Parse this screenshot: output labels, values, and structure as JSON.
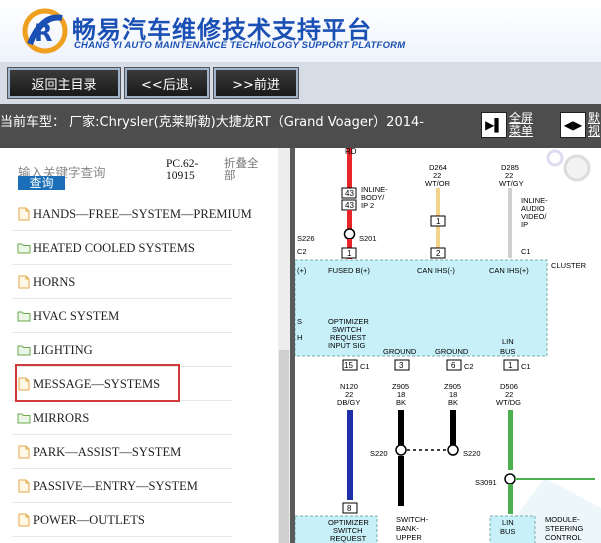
{
  "header": {
    "title_cn": "畅易汽车维修技术支持平台",
    "title_en": "CHANG YI AUTO MAINTENANCE TECHNOLOGY SUPPORT PLATFORM"
  },
  "toolbar": {
    "back_home": "返回主目录",
    "prev": "<<后退.",
    "next": ">>前进"
  },
  "model_bar": {
    "text": "当前车型： 厂家:Chrysler(克莱斯勒)大捷龙RT（Grand Voager）2014-",
    "fullscreen_line1": "全屏",
    "fullscreen_line2": "菜单",
    "default_line1": "默",
    "default_line2": "视"
  },
  "sidebar": {
    "search_placeholder": "输入关键字查询",
    "search_button": "查询",
    "pc_code_line1": "PC.62-",
    "pc_code_line2": "10915",
    "collapse_line1": "折叠全",
    "collapse_line2": "部",
    "items": [
      {
        "label": "HANDS—FREE—SYSTEM—PREMIUM",
        "icon": "file-icon"
      },
      {
        "label": "HEATED COOLED SYSTEMS",
        "icon": "folder-icon"
      },
      {
        "label": "HORNS",
        "icon": "file-icon"
      },
      {
        "label": "HVAC SYSTEM",
        "icon": "folder-icon"
      },
      {
        "label": "LIGHTING",
        "icon": "folder-icon"
      },
      {
        "label": "MESSAGE—SYSTEMS",
        "icon": "file-icon"
      },
      {
        "label": "MIRRORS",
        "icon": "folder-icon"
      },
      {
        "label": "PARK—ASSIST—SYSTEM",
        "icon": "file-icon"
      },
      {
        "label": "PASSIVE—ENTRY—SYSTEM",
        "icon": "file-icon"
      },
      {
        "label": "POWER—OUTLETS",
        "icon": "file-icon"
      }
    ]
  },
  "diagram": {
    "rd": "RD",
    "d264": "D264",
    "d264_gauge": "22",
    "d264_color": "WT/OR",
    "d285": "D285",
    "d285_gauge": "22",
    "d285_color": "WT/GY",
    "pin43a": "43",
    "inline_body_1": "INLINE-",
    "inline_body_2": "BODY/",
    "inline_body_3": "IP 2",
    "pin43b": "43",
    "pin1a": "1",
    "pin1b": "1",
    "pin2a": "2",
    "inline_audio_1": "INLINE-",
    "inline_audio_2": "AUDIO",
    "inline_audio_3": "VIDEO/",
    "inline_audio_4": "IP",
    "s226": "S226",
    "c2": "C2",
    "s201": "S201",
    "c1a": "C1",
    "cluster": "CLUSTER",
    "lbl_b": "(+)",
    "lbl_fused": "FUSED B(+)",
    "lbl_ihs_minus": "CAN IHS(-)",
    "lbl_ihs_plus": "CAN IHS(+)",
    "lbl_s": "S",
    "lbl_h": "H",
    "lbl_optimizer_1": "OPTIMIZER",
    "lbl_optimizer_2": "SWITCH",
    "lbl_optimizer_3": "REQUEST",
    "lbl_optimizer_4": "INPUT SIG",
    "lbl_ground1": "GROUND",
    "lbl_ground2": "GROUND",
    "lbl_lin": "LIN",
    "lbl_bus": "BUS",
    "pin15": "15",
    "c1b": "C1",
    "pin3": "3",
    "pin6": "6",
    "c2b": "C2",
    "pin1c": "1",
    "c1c": "C1",
    "n120": "N120",
    "n120_gauge": "22",
    "n120_color": "DB/GY",
    "z905a": "Z905",
    "z905a_gauge": "18",
    "z905a_color": "BK",
    "z905b": "Z905",
    "z905b_gauge": "18",
    "z905b_color": "BK",
    "d506": "D506",
    "d506_gauge": "22",
    "d506_color": "WT/DG",
    "s220a": "S220",
    "s220b": "S220",
    "s3091": "S3091",
    "pin8": "8",
    "bot_optimizer_1": "OPTIMIZER",
    "bot_optimizer_2": "SWITCH",
    "bot_optimizer_3": "REQUEST",
    "bot_switch_1": "SWITCH-",
    "bot_switch_2": "BANK-",
    "bot_switch_3": "UPPER",
    "bot_lin_1": "LIN",
    "bot_lin_2": "BUS",
    "bot_module_1": "MODULE-",
    "bot_module_2": "STEERING",
    "bot_module_3": "CONTROL"
  },
  "colors": {
    "brand_blue": "#1a4fb3",
    "highlight_red": "#d23a3a",
    "diagram_cyan": "#c8f0f8",
    "wire_red": "#e8262a"
  }
}
